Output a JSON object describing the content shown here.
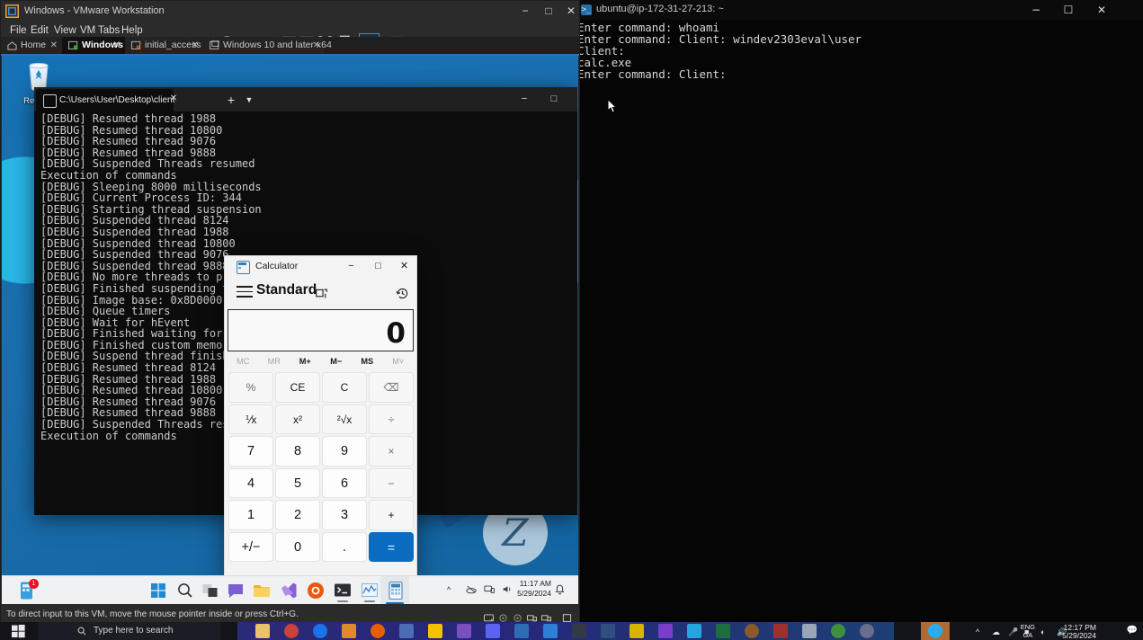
{
  "host": {
    "taskbar": {
      "search_placeholder": "Type here to search",
      "start_icon": "windows-start-icon",
      "search_icon": "search-icon",
      "pinned": [
        {
          "name": "file-explorer-icon",
          "color": "#e9c26b"
        },
        {
          "name": "cherry-app-icon",
          "color": "#c9423c"
        },
        {
          "name": "google-chrome-icon",
          "color": "#1a73e8"
        },
        {
          "name": "vmware-workstation-icon",
          "color": "#e08b2a"
        },
        {
          "name": "firefox-icon",
          "color": "#e66000"
        },
        {
          "name": "burp-suite-icon",
          "color": "#4b6cb7"
        },
        {
          "name": "sticky-notes-icon",
          "color": "#f2c200"
        },
        {
          "name": "vs-code-insiders-icon",
          "color": "#7a4fbf"
        },
        {
          "name": "flash-app-icon",
          "color": "#5b63f2"
        },
        {
          "name": "powershell-icon",
          "color": "#2d6db5"
        },
        {
          "name": "vs-code-icon",
          "color": "#2d7fd6"
        },
        {
          "name": "terminal-icon",
          "color": "#333a45"
        },
        {
          "name": "ida-pro-icon",
          "color": "#2f4f7f"
        },
        {
          "name": "keepass-icon",
          "color": "#d7b400"
        },
        {
          "name": "ghidra-icon",
          "color": "#7a3ecb"
        },
        {
          "name": "todoist-icon",
          "color": "#27a3e0"
        },
        {
          "name": "excel-icon",
          "color": "#1d6f42"
        },
        {
          "name": "bear-app-icon",
          "color": "#8a5a2b"
        },
        {
          "name": "spider-app-icon",
          "color": "#a03030"
        },
        {
          "name": "windows-sandbox-icon",
          "color": "#9aa6b5"
        },
        {
          "name": "chrome-beta-icon",
          "color": "#3f8f3f"
        },
        {
          "name": "tor-browser-icon",
          "color": "#6c6c8c"
        },
        {
          "name": "telegram-icon",
          "color": "#2aabee"
        }
      ],
      "lang_line1": "ENG",
      "lang_line2": "GA",
      "time": "12:17 PM",
      "date": "5/29/2024",
      "tray_icons": [
        "chevron-up-icon",
        "onedrive-icon",
        "microphone-icon",
        "battery-icon",
        "network-icon",
        "volume-icon"
      ],
      "notifications_icon": "action-center-icon"
    }
  },
  "terminal": {
    "title": "ubuntu@ip-172-31-27-213: ~",
    "icon": "ssh-terminal-icon",
    "window_buttons": [
      "minimize",
      "maximize",
      "close"
    ],
    "lines": [
      "Enter command: whoami",
      "Enter command: Client: windev2303eval\\user",
      "Client:",
      "calc.exe",
      "Enter command: Client:"
    ]
  },
  "vmware": {
    "title": "Windows - VMware Workstation",
    "logo_icon": "vmware-logo-icon",
    "window_buttons": [
      "minimize",
      "maximize",
      "close"
    ],
    "menus": [
      "File",
      "Edit",
      "View",
      "VM",
      "Tabs",
      "Help"
    ],
    "toolbar_icons": [
      "pause-vm-icon",
      "pause-dropdown-icon",
      "snapshot-manager-icon",
      "revert-snapshot-icon",
      "take-snapshot-icon",
      "manage-snapshots-icon",
      "show-library-icon",
      "show-thumbnails-icon",
      "full-screen-icon",
      "unity-mode-icon",
      "console-view-icon",
      "stretch-guest-icon",
      "stretch-dropdown-icon"
    ],
    "tabs": [
      {
        "label": "Home",
        "icon": "home-icon",
        "active": false
      },
      {
        "label": "Windows",
        "icon": "vm-powered-on-icon",
        "active": true
      },
      {
        "label": "initial_access",
        "icon": "vm-suspended-icon",
        "active": false
      },
      {
        "label": "Windows 10 and later x64",
        "icon": "vm-powered-off-icon",
        "active": false
      }
    ],
    "status_text": "To direct input to this VM, move the mouse pointer inside or press Ctrl+G.",
    "status_icons": [
      "hard-disk-icon",
      "cd-drive-icon",
      "cd-drive2-icon",
      "network-adapter-icon",
      "network-adapter2-icon",
      "usb-icon"
    ]
  },
  "guest": {
    "desktop": {
      "recycle_bin_label": "Recycle",
      "recycle_bin_icon": "recycle-bin-icon"
    },
    "windows_terminal": {
      "tab_title": "C:\\Users\\User\\Desktop\\client",
      "tab_icon": "command-prompt-icon",
      "new_tab_icon": "plus-icon",
      "dropdown_icon": "chevron-down-icon",
      "close_icon": "close-icon",
      "window_buttons": [
        "minimize",
        "maximize"
      ],
      "lines": [
        "[DEBUG] Resumed thread 1988",
        "[DEBUG] Resumed thread 10800",
        "[DEBUG] Resumed thread 9076",
        "[DEBUG] Resumed thread 9888",
        "[DEBUG] Suspended Threads resumed",
        "Execution of commands",
        "[DEBUG] Sleeping 8000 milliseconds",
        "[DEBUG] Current Process ID: 344",
        "[DEBUG] Starting thread suspension",
        "[DEBUG] Suspended thread 8124",
        "[DEBUG] Suspended thread 1988",
        "[DEBUG] Suspended thread 10800",
        "[DEBUG] Suspended thread 9076",
        "[DEBUG] Suspended thread 9888",
        "[DEBUG] No more threads to process",
        "[DEBUG] Finished suspending threads",
        "[DEBUG] Image base: 0x8D0000, Image",
        "[DEBUG] Queue timers",
        "[DEBUG] Wait for hEvent",
        "[DEBUG] Finished waiting for event",
        "[DEBUG] Finished custom memory encr",
        "[DEBUG] Suspend thread finished[DEB",
        "[DEBUG] Resumed thread 8124",
        "[DEBUG] Resumed thread 1988",
        "[DEBUG] Resumed thread 10800",
        "[DEBUG] Resumed thread 9076",
        "[DEBUG] Resumed thread 9888",
        "[DEBUG] Suspended Threads resumed",
        "Execution of commands"
      ]
    },
    "calculator": {
      "window_title": "Calculator",
      "app_icon": "calculator-icon",
      "window_buttons": [
        "minimize",
        "maximize",
        "close"
      ],
      "hamburger_icon": "hamburger-menu-icon",
      "mode": "Standard",
      "keep_on_top_icon": "keep-on-top-icon",
      "history_icon": "history-icon",
      "display_value": "0",
      "memory_buttons": [
        {
          "label": "MC",
          "enabled": false
        },
        {
          "label": "MR",
          "enabled": false
        },
        {
          "label": "M+",
          "enabled": true
        },
        {
          "label": "M−",
          "enabled": true
        },
        {
          "label": "MS",
          "enabled": true
        },
        {
          "label": "M˅",
          "enabled": false
        }
      ],
      "keypad": [
        [
          {
            "label": "%",
            "type": "fn"
          },
          {
            "label": "CE",
            "type": "fn"
          },
          {
            "label": "C",
            "type": "fn"
          },
          {
            "label": "⌫",
            "type": "fn"
          }
        ],
        [
          {
            "label": "⅟x",
            "type": "fn"
          },
          {
            "label": "x²",
            "type": "fn"
          },
          {
            "label": "²√x",
            "type": "fn"
          },
          {
            "label": "÷",
            "type": "fn"
          }
        ],
        [
          {
            "label": "7",
            "type": "num"
          },
          {
            "label": "8",
            "type": "num"
          },
          {
            "label": "9",
            "type": "num"
          },
          {
            "label": "×",
            "type": "fn"
          }
        ],
        [
          {
            "label": "4",
            "type": "num"
          },
          {
            "label": "5",
            "type": "num"
          },
          {
            "label": "6",
            "type": "num"
          },
          {
            "label": "−",
            "type": "fn"
          }
        ],
        [
          {
            "label": "1",
            "type": "num"
          },
          {
            "label": "2",
            "type": "num"
          },
          {
            "label": "3",
            "type": "num"
          },
          {
            "label": "+",
            "type": "fn"
          }
        ],
        [
          {
            "label": "+/−",
            "type": "num"
          },
          {
            "label": "0",
            "type": "num"
          },
          {
            "label": ".",
            "type": "num"
          },
          {
            "label": "=",
            "type": "eq"
          }
        ]
      ],
      "accent_color": "#0a6cc1"
    },
    "taskbar": {
      "apps": [
        {
          "name": "start-button-icon"
        },
        {
          "name": "search-icon"
        },
        {
          "name": "task-view-icon"
        },
        {
          "name": "chat-icon"
        },
        {
          "name": "file-explorer-icon"
        },
        {
          "name": "vs-code-icon"
        },
        {
          "name": "firefox-icon"
        },
        {
          "name": "windows-terminal-icon"
        },
        {
          "name": "process-hacker-icon"
        },
        {
          "name": "calculator-icon"
        }
      ],
      "notification_badge": "1",
      "time": "11:17 AM",
      "date": "5/29/2024",
      "tray_icons": [
        "chevron-up-icon",
        "onedrive-icon",
        "network-icon",
        "volume-icon"
      ],
      "bell_icon": "notification-bell-icon"
    }
  }
}
